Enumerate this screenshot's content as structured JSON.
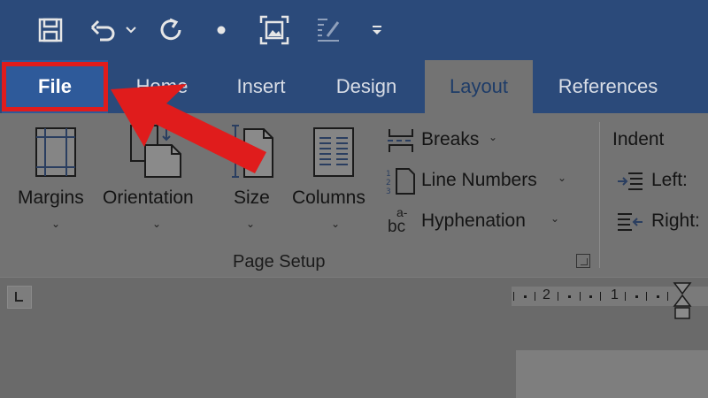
{
  "tabs": {
    "file": "File",
    "home": "Home",
    "insert": "Insert",
    "design": "Design",
    "layout": "Layout",
    "references": "References"
  },
  "page_setup": {
    "margins": "Margins",
    "orientation": "Orientation",
    "size": "Size",
    "columns": "Columns",
    "breaks": "Breaks",
    "line_numbers": "Line Numbers",
    "hyphenation": "Hyphenation",
    "hyphen_icon_top": "a-",
    "hyphen_icon_bottom": "bc",
    "group_label": "Page Setup"
  },
  "paragraph": {
    "indent": "Indent",
    "left": "Left:",
    "right": "Right:"
  },
  "ruler": {
    "n2": "2",
    "n1": "1"
  },
  "colors": {
    "title_bar": "#2b4a7a",
    "highlight": "#e01c1c"
  }
}
